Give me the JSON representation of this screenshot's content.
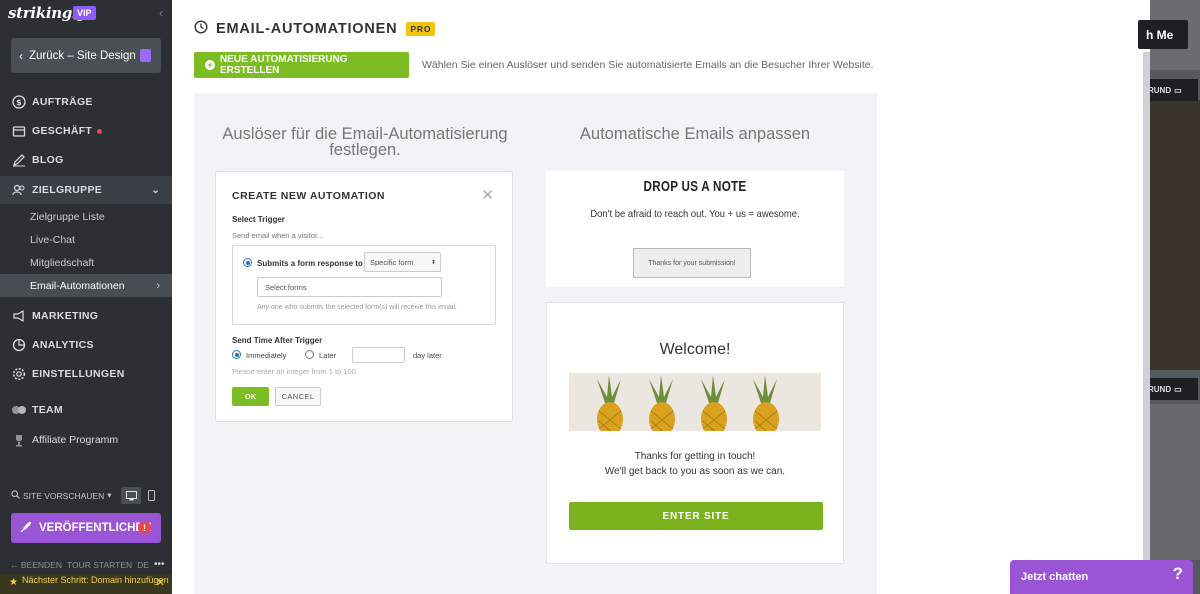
{
  "sidebar": {
    "logo": "strikingly",
    "vip": "VIP",
    "back_label": "Zurück – Site Design",
    "items": [
      {
        "label": "AUFTRÄGE"
      },
      {
        "label": "GESCHÄFT"
      },
      {
        "label": "BLOG"
      },
      {
        "label": "ZIELGRUPPE"
      },
      {
        "label": "MARKETING"
      },
      {
        "label": "ANALYTICS"
      },
      {
        "label": "EINSTELLUNGEN"
      },
      {
        "label": "TEAM"
      },
      {
        "label": "Affiliate Programm"
      }
    ],
    "sub_items": [
      {
        "label": "Zielgruppe Liste"
      },
      {
        "label": "Live-Chat"
      },
      {
        "label": "Mitgliedschaft"
      },
      {
        "label": "Email-Automationen"
      }
    ],
    "site_preview": "SITE VORSCHAUEN",
    "publish": "VERÖFFENTLICHEN",
    "publish_badge": "!",
    "footer": {
      "end": "BEENDEN",
      "tour": "TOUR STARTEN",
      "lang": "DE",
      "more": "•••"
    },
    "next_step": "Nächster Schritt: Domain hinzufügen"
  },
  "main": {
    "title": "EMAIL-AUTOMATIONEN",
    "pro_badge": "PRO",
    "new_button": "NEUE AUTOMATISIERUNG ERSTELLEN",
    "hint": "Wählen Sie einen Auslöser und senden Sie automatisierte Emails an die Besucher Ihrer Website.",
    "left_title": "Auslöser für die Email-Automatisierung festlegen.",
    "right_title": "Automatische Emails anpassen",
    "modal": {
      "title": "CREATE NEW AUTOMATION",
      "select_trigger": "Select Trigger",
      "send_when": "Send email when a visitor...",
      "submits_label": "Submits a form response to",
      "specific_form": "Specific form",
      "select_forms": "Select forms",
      "any_one": "Any one who submits the selected form(s) will receive this email.",
      "send_time": "Send Time After Trigger",
      "immediately": "Immediately",
      "later": "Later",
      "day_later": "day later",
      "integer_hint": "Please enter an integer  from 1 to 100.",
      "ok": "OK",
      "cancel": "CANCEL"
    },
    "email1": {
      "title": "DROP US A NOTE",
      "subtitle": "Don't be afraid to reach out. You + us = awesome.",
      "button": "Thanks for your submission!"
    },
    "email2": {
      "welcome": "Welcome!",
      "line1": "Thanks for getting in touch!",
      "line2": "We'll get back to you as soon as we can.",
      "button": "ENTER SITE"
    }
  },
  "right": {
    "top_button": "h Me",
    "grund1": "RUND",
    "grund2": "RUND",
    "chat": "Jetzt chatten",
    "chat_help": "?"
  },
  "colors": {
    "accent_green": "#7dbd24",
    "purple": "#9a55d6",
    "sidebar": "#2c2f34",
    "pro": "#f1c40f"
  }
}
